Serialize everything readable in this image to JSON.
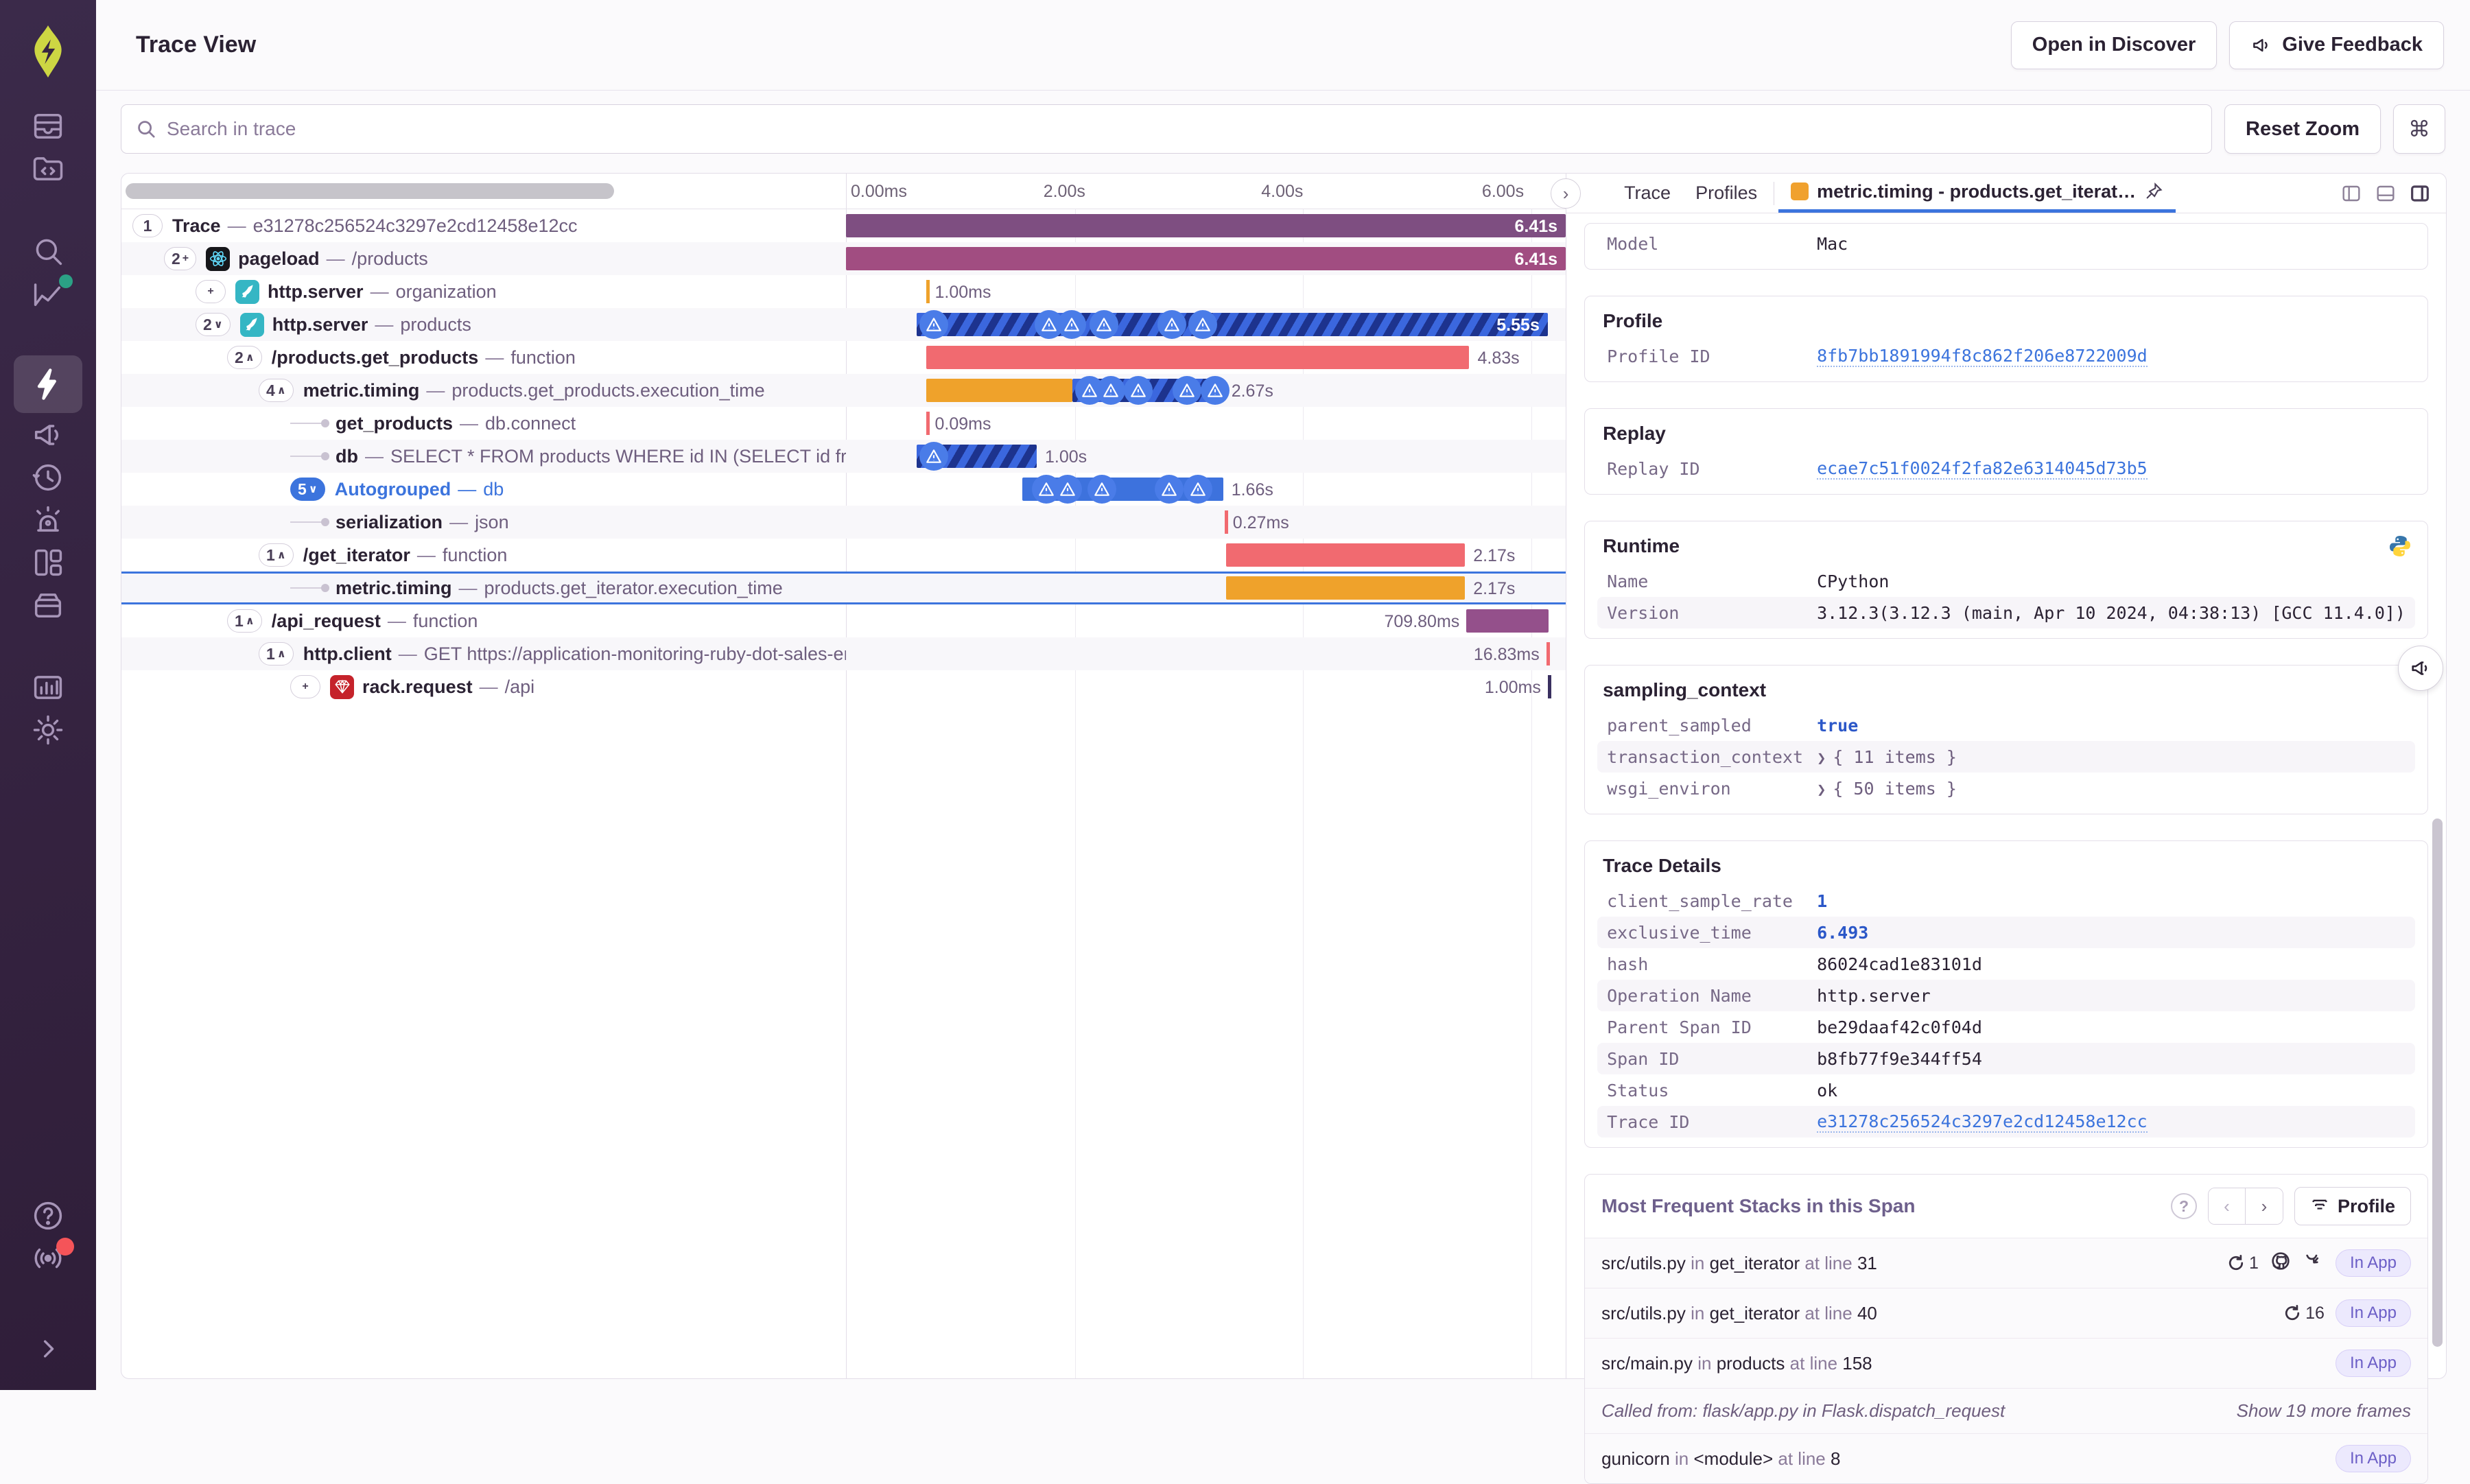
{
  "header": {
    "title": "Trace View",
    "open_in_discover": "Open in Discover",
    "give_feedback": "Give Feedback"
  },
  "toolbar": {
    "search_placeholder": "Search in trace",
    "reset_zoom": "Reset Zoom",
    "shortcut_key": "⌘"
  },
  "timeline": {
    "ticks": [
      "0.00ms",
      "2.00s",
      "4.00s",
      "6.00s"
    ]
  },
  "spans": [
    {
      "pill": "1",
      "depth": 0,
      "name": "Trace",
      "op": "e31278c256524c3297e2cd12458e12cc",
      "duration": "6.41s",
      "bar": {
        "segments": [
          {
            "s": 0,
            "w": 100,
            "f": "purple"
          }
        ],
        "labelPos": "inside"
      }
    },
    {
      "pill": "2+",
      "depth": 1,
      "icon": "react",
      "name": "pageload",
      "op": "/products",
      "duration": "6.41s",
      "bar": {
        "segments": [
          {
            "s": 0,
            "w": 100,
            "f": "magenta"
          }
        ],
        "labelPos": "inside"
      }
    },
    {
      "pill": "+",
      "depth": 2,
      "icon": "flask",
      "name": "http.server",
      "op": "organization",
      "duration": "1.00ms",
      "bar": {
        "tick": {
          "s": 11.2,
          "f": "t-orange"
        },
        "labelPos": "after"
      }
    },
    {
      "pill": "2∨",
      "depth": 2,
      "icon": "flask",
      "name": "http.server",
      "op": "products",
      "duration": "5.55s",
      "bar": {
        "segments": [
          {
            "s": 9.8,
            "w": 87.7,
            "f": "striped"
          }
        ],
        "labelPos": "inside",
        "warnings": [
          10.2,
          26.2,
          29.4,
          33.8,
          43.3,
          47.6
        ]
      }
    },
    {
      "pill": "2∧",
      "depth": 3,
      "name": "/products.get_products",
      "op": "function",
      "duration": "4.83s",
      "bar": {
        "segments": [
          {
            "s": 11.2,
            "w": 75.4,
            "f": "red"
          }
        ],
        "labelPos": "after"
      }
    },
    {
      "pill": "4∧",
      "depth": 4,
      "name": "metric.timing",
      "op": "products.get_products.execution_time",
      "duration": "2.67s",
      "bar": {
        "segments": [
          {
            "s": 11.2,
            "w": 20.3,
            "f": "orange"
          },
          {
            "s": 31.5,
            "w": 20.9,
            "f": "striped"
          }
        ],
        "labelPos": "after",
        "warnings": [
          31.8,
          34.8,
          38.6,
          45.4,
          49.3
        ]
      }
    },
    {
      "conn": true,
      "depth": 5,
      "name": "get_products",
      "op": "db.connect",
      "duration": "0.09ms",
      "bar": {
        "tick": {
          "s": 11.2,
          "f": "t-red"
        },
        "labelPos": "after"
      }
    },
    {
      "conn": true,
      "depth": 5,
      "name": "db",
      "op": "SELECT * FROM products WHERE id IN (SELECT id from produ",
      "duration": "1.00s",
      "bar": {
        "segments": [
          {
            "s": 9.8,
            "w": 16.7,
            "f": "striped"
          }
        ],
        "labelPos": "after",
        "warnings": [
          10.2
        ]
      }
    },
    {
      "pill": "5∨",
      "pillBlue": true,
      "depth": 5,
      "name": "Autogrouped",
      "op": "db",
      "blueText": true,
      "duration": "1.66s",
      "bar": {
        "segments": [
          {
            "s": 24.5,
            "w": 27.9,
            "f": "blue"
          }
        ],
        "labelPos": "after",
        "warnings": [
          25.8,
          28.8,
          33.6,
          42.9,
          46.9
        ]
      }
    },
    {
      "conn": true,
      "depth": 5,
      "name": "serialization",
      "op": "json",
      "duration": "0.27ms",
      "bar": {
        "tick": {
          "s": 52.6,
          "f": "t-red"
        },
        "labelPos": "after"
      }
    },
    {
      "pill": "1∧",
      "depth": 4,
      "name": "/get_iterator",
      "op": "function",
      "duration": "2.17s",
      "bar": {
        "segments": [
          {
            "s": 52.8,
            "w": 33.2,
            "f": "red"
          }
        ],
        "labelPos": "after"
      }
    },
    {
      "conn": true,
      "depth": 5,
      "selected": true,
      "name": "metric.timing",
      "op": "products.get_iterator.execution_time",
      "duration": "2.17s",
      "bar": {
        "segments": [
          {
            "s": 52.8,
            "w": 33.2,
            "f": "orange"
          }
        ],
        "labelPos": "after"
      }
    },
    {
      "pill": "1∧",
      "depth": 3,
      "name": "/api_request",
      "op": "function",
      "duration": "709.80ms",
      "bar": {
        "segments": [
          {
            "s": 86.2,
            "w": 11.4,
            "f": "purple2"
          }
        ],
        "labelPos": "before"
      }
    },
    {
      "pill": "1∧",
      "depth": 4,
      "name": "http.client",
      "op": "GET https://application-monitoring-ruby-dot-sales-eng",
      "duration": "16.83ms",
      "bar": {
        "tick": {
          "s": 97.3,
          "f": "t-red"
        },
        "labelPos": "before"
      }
    },
    {
      "pill": "+",
      "depth": 5,
      "icon": "ruby",
      "name": "rack.request",
      "op": "/api",
      "duration": "1.00ms",
      "bar": {
        "tick": {
          "s": 97.5,
          "f": "t-dark"
        },
        "labelPos": "before"
      }
    }
  ],
  "drawer": {
    "tabs": [
      {
        "label": "Trace"
      },
      {
        "label": "Profiles"
      },
      {
        "label": "metric.timing - products.get_iterat…",
        "active": true,
        "pinned": true
      }
    ],
    "cards": [
      {
        "rows": [
          {
            "k": "Model",
            "v": "Mac"
          }
        ]
      },
      {
        "title": "Profile",
        "rows": [
          {
            "k": "Profile ID",
            "v": "8fb7bb1891994f8c862f206e8722009d",
            "type": "link"
          }
        ]
      },
      {
        "title": "Replay",
        "rows": [
          {
            "k": "Replay ID",
            "v": "ecae7c51f0024f2fa82e6314045d73b5",
            "type": "link"
          }
        ]
      },
      {
        "title": "Runtime",
        "logo": "python",
        "rows": [
          {
            "k": "Name",
            "v": "CPython"
          },
          {
            "k": "Version",
            "v": "3.12.3(3.12.3 (main, Apr 10 2024, 04:38:13) [GCC 11.4.0])"
          }
        ]
      },
      {
        "title": "sampling_context",
        "rows": [
          {
            "k": "parent_sampled",
            "v": "true",
            "type": "blue"
          },
          {
            "k": "transaction_context",
            "v": "{ 11 items }",
            "type": "expand"
          },
          {
            "k": "wsgi_environ",
            "v": "{ 50 items }",
            "type": "expand"
          }
        ]
      },
      {
        "title": "Trace Details",
        "rows": [
          {
            "k": "client_sample_rate",
            "v": "1",
            "type": "blue"
          },
          {
            "k": "exclusive_time",
            "v": "6.493",
            "type": "blue"
          },
          {
            "k": "hash",
            "v": "86024cad1e83101d"
          },
          {
            "k": "Operation Name",
            "v": "http.server"
          },
          {
            "k": "Parent Span ID",
            "v": "be29daaf42c0f04d"
          },
          {
            "k": "Span ID",
            "v": "b8fb77f9e344ff54"
          },
          {
            "k": "Status",
            "v": "ok"
          },
          {
            "k": "Trace ID",
            "v": "e31278c256524c3297e2cd12458e12cc",
            "type": "link"
          }
        ]
      }
    ],
    "stacks": {
      "title": "Most Frequent Stacks in this Span",
      "profile_button": "Profile",
      "in_label": "in",
      "at_line_label": "at line",
      "in_app_badge": "In App",
      "rows": [
        {
          "file": "src/utils.py",
          "fn": "get_iterator",
          "line": "31",
          "loop_count": "1",
          "github": true,
          "branch": true,
          "in_app": true
        },
        {
          "file": "src/utils.py",
          "fn": "get_iterator",
          "line": "40",
          "loop_count": "16",
          "in_app": true
        },
        {
          "file": "src/main.py",
          "fn": "products",
          "line": "158",
          "in_app": true
        },
        {
          "called_from": "Called from: flask/app.py in Flask.dispatch_request",
          "more": "Show 19 more frames"
        },
        {
          "file": "gunicorn",
          "fn": "<module>",
          "line": "8",
          "in_app": true
        }
      ]
    }
  },
  "colors": {
    "accent_blue": "#3c74dd",
    "bar_purple": "#7e4e81",
    "bar_magenta": "#a14d81",
    "bar_red": "#f16a70",
    "bar_orange": "#efa22b",
    "bar_blue": "#3d72dd",
    "sidebar_bg": "#34223f",
    "logo_lime": "#cdd643"
  }
}
